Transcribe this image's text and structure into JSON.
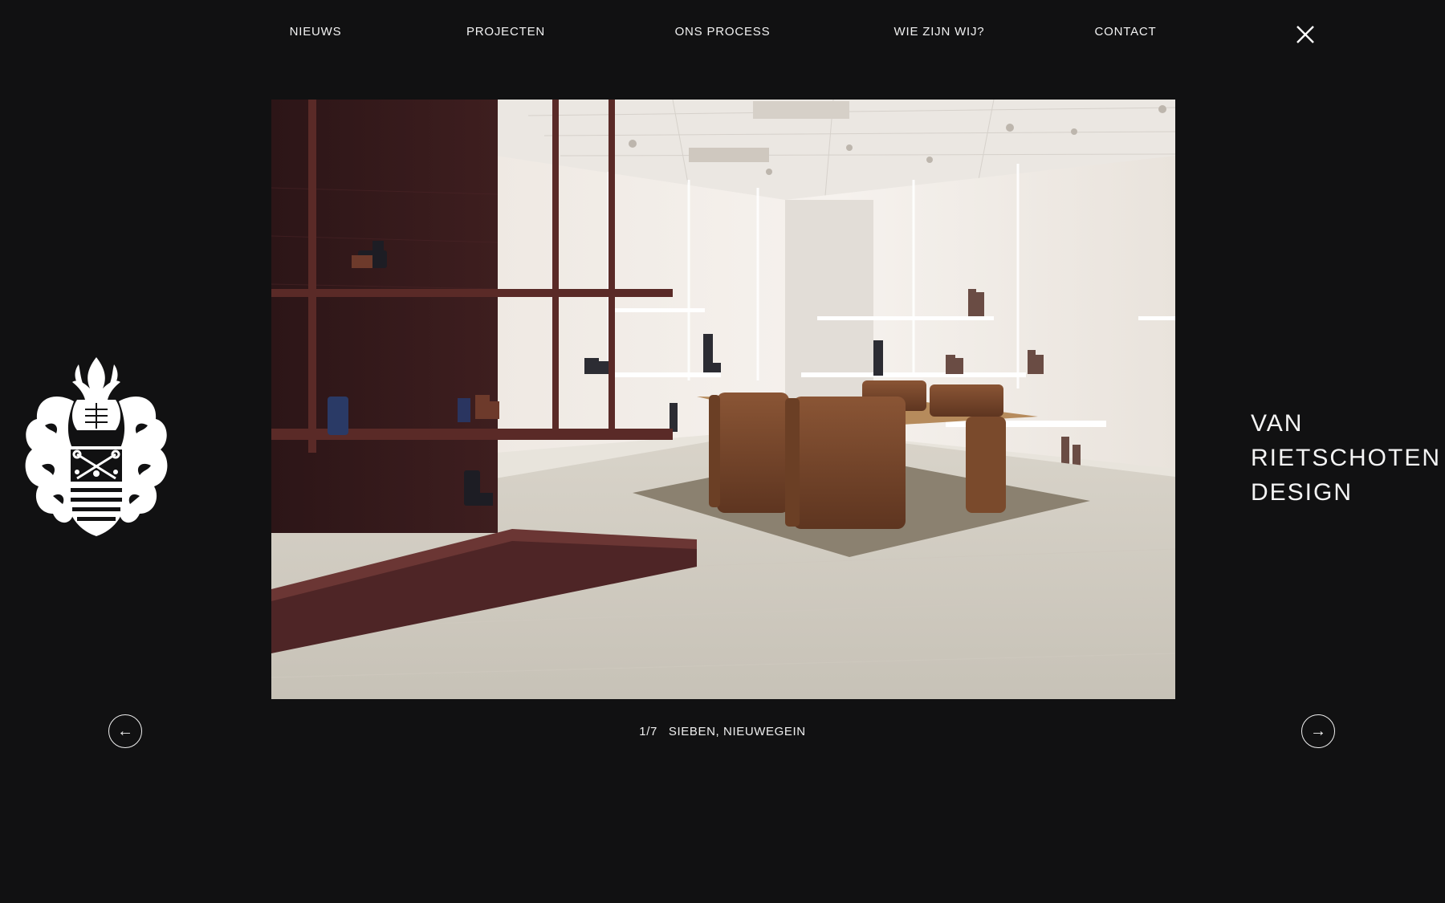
{
  "nav": {
    "items": [
      {
        "label": "NIEUWS"
      },
      {
        "label": "PROJECTEN"
      },
      {
        "label": "ONS PROCESS"
      },
      {
        "label": "WIE ZIJN WIJ?"
      },
      {
        "label": "CONTACT"
      }
    ],
    "close_icon": "close-icon"
  },
  "brand": {
    "line1": "VAN",
    "line2": "RIETSCHOTEN",
    "line3": "DESIGN"
  },
  "logo": {
    "icon": "coat-of-arms-icon"
  },
  "slideshow": {
    "counter": "1/7",
    "caption": "SIEBEN, NIEUWEGEIN",
    "prev_icon": "←",
    "next_icon": "→"
  },
  "colors": {
    "background": "#111112",
    "text": "#ffffff",
    "accent_shelf": "#5a2a27"
  }
}
